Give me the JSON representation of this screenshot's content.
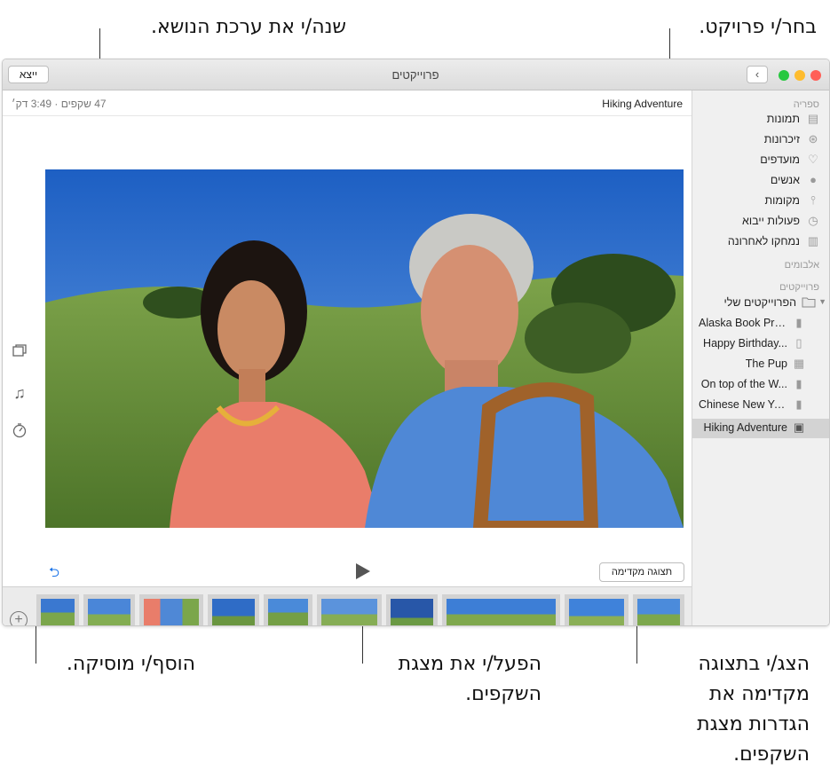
{
  "callouts": {
    "theme": "שנה/י את ערכת הנושא.",
    "project": "בחר/י פרויקט.",
    "music": "הוסף/י מוסיקה.",
    "play_line1": "הפעל/י את מצגת",
    "play_line2": "השקפים.",
    "preview_line1": "הצג/י בתצוגה",
    "preview_line2": "מקדימה את",
    "preview_line3": "הגדרות מצגת",
    "preview_line4": "השקפים."
  },
  "window": {
    "title": "פרוייקטים",
    "export_label": "ייצא",
    "back_icon": "chevron-left-icon",
    "traffic_colors": [
      "#28c840",
      "#febc2e",
      "#ff5f57"
    ]
  },
  "project": {
    "name": "Hiking Adventure",
    "meta": "47 שקפים · 3:49 דק׳"
  },
  "sidebar": {
    "library_header": "ספריה",
    "library": [
      {
        "label": "תמונות",
        "icon": "photos-icon",
        "glyph": "▤"
      },
      {
        "label": "זיכרונות",
        "icon": "memories-icon",
        "glyph": "⊛"
      },
      {
        "label": "מועדפים",
        "icon": "heart-icon",
        "glyph": "♡"
      },
      {
        "label": "אנשים",
        "icon": "people-icon",
        "glyph": "●"
      },
      {
        "label": "מקומות",
        "icon": "pin-icon",
        "glyph": "⫯"
      },
      {
        "label": "פעולות ייבוא",
        "icon": "clock-icon",
        "glyph": "◷"
      },
      {
        "label": "נמחקו לאחרונה",
        "icon": "trash-icon",
        "glyph": "▥"
      }
    ],
    "albums_header": "אלבומים",
    "projects_header": "פרוייקטים",
    "folder": {
      "label": "הפרוייקטים שלי",
      "icon": "folder-icon"
    },
    "projects": [
      {
        "label": "Alaska Book Proj...",
        "icon": "book-icon"
      },
      {
        "label": "Happy Birthday...",
        "icon": "card-icon"
      },
      {
        "label": "The Pup",
        "icon": "calendar-icon"
      },
      {
        "label": "On top of the W...",
        "icon": "book-icon"
      },
      {
        "label": "Chinese New Year",
        "icon": "book-icon"
      },
      {
        "label": "Hiking Adventure",
        "icon": "slideshow-icon",
        "selected": true
      }
    ]
  },
  "player": {
    "preview_label": "תצוגה מקדימה",
    "play_icon": "play-icon",
    "loop_icon": "loop-icon"
  },
  "tools": {
    "theme_icon": "theme-icon",
    "music_icon": "music-note-icon",
    "duration_icon": "timer-icon"
  },
  "filmstrip": {
    "add_icon": "add-circle-icon",
    "slides": [
      "10",
      "9",
      "8",
      "7",
      "6",
      "5",
      "4",
      "3",
      "2",
      "1"
    ]
  }
}
